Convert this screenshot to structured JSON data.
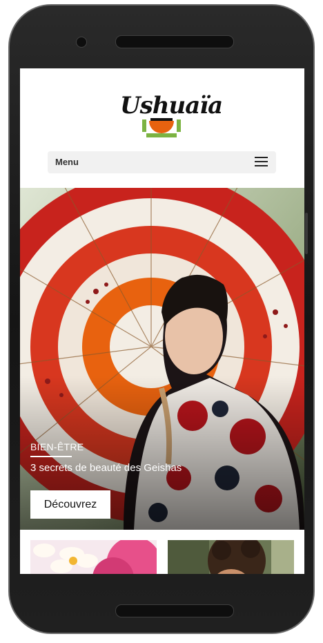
{
  "header": {
    "logo_text": "Ushuaïa",
    "menu_label": "Menu"
  },
  "hero": {
    "category": "BIEN-ÊTRE",
    "title": "3 secrets de beauté des Geishas",
    "cta_label": "Découvrez"
  },
  "colors": {
    "accent_orange": "#e8620f",
    "logo_green": "#7cb342",
    "umbrella_red": "#c8231d"
  },
  "icons": {
    "menu": "hamburger-icon"
  }
}
